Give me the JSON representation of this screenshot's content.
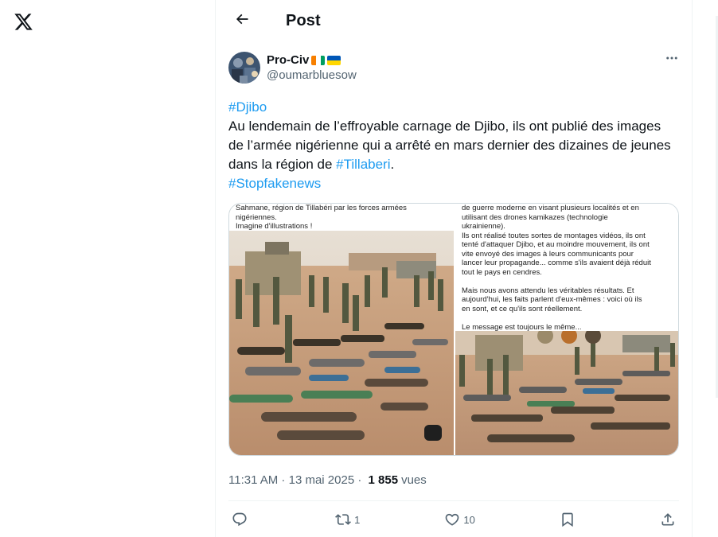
{
  "header": {
    "title": "Post"
  },
  "author": {
    "display_name": "Pro-Civ",
    "handle": "@oumarbluesow"
  },
  "tweet": {
    "hashtag_1": "#Djibo",
    "body_part_1": "Au lendemain de l’effroyable carnage de Djibo, ils ont publié des images de l’armée nigérienne qui a arrêté en mars dernier des dizaines de jeunes dans la région de ",
    "hashtag_2": "#Tillaberi",
    "body_part_2": ".",
    "hashtag_3": "#Stopfakenews"
  },
  "media": {
    "left_caption": "Sahmane, région de Tillabéri par les forces armées\nnigériennes.\nImagine d'illustrations !",
    "right_caption": "de guerre moderne en visant plusieurs localités et en\nutilisant des drones kamikazes (technologie\nukrainienne).\nIls ont réalisé toutes sortes de montages vidéos, ils ont\ntenté d'attaquer Djibo, et au moindre mouvement, ils ont\nvite envoyé des images à leurs communicants pour\nlancer leur propagande... comme s'ils avaient déjà réduit\ntout le pays en cendres.\n\nMais nous avons attendu les véritables résultats. Et\naujourd'hui, les faits parlent d'eux-mêmes : voici où ils\nen sont, et ce qu'ils sont réellement.\n\nLe message est toujours le même..."
  },
  "meta": {
    "time": "11:31 AM",
    "separator": " · ",
    "date": "13 mai 2025",
    "separator_2": " · ",
    "views": "1 855",
    "views_label": "vues"
  },
  "actions": {
    "reply_count": "",
    "repost_count": "1",
    "like_count": "10"
  },
  "icons": {
    "logo": "x-logo-icon",
    "back": "arrow-left-icon",
    "more": "more-horizontal-icon",
    "reply": "reply-icon",
    "repost": "repost-icon",
    "like": "heart-icon",
    "bookmark": "bookmark-icon",
    "share": "share-icon"
  },
  "colors": {
    "link": "#1d9bf0",
    "text": "#0f1419",
    "secondary": "#536471",
    "border": "#eff3f4"
  }
}
